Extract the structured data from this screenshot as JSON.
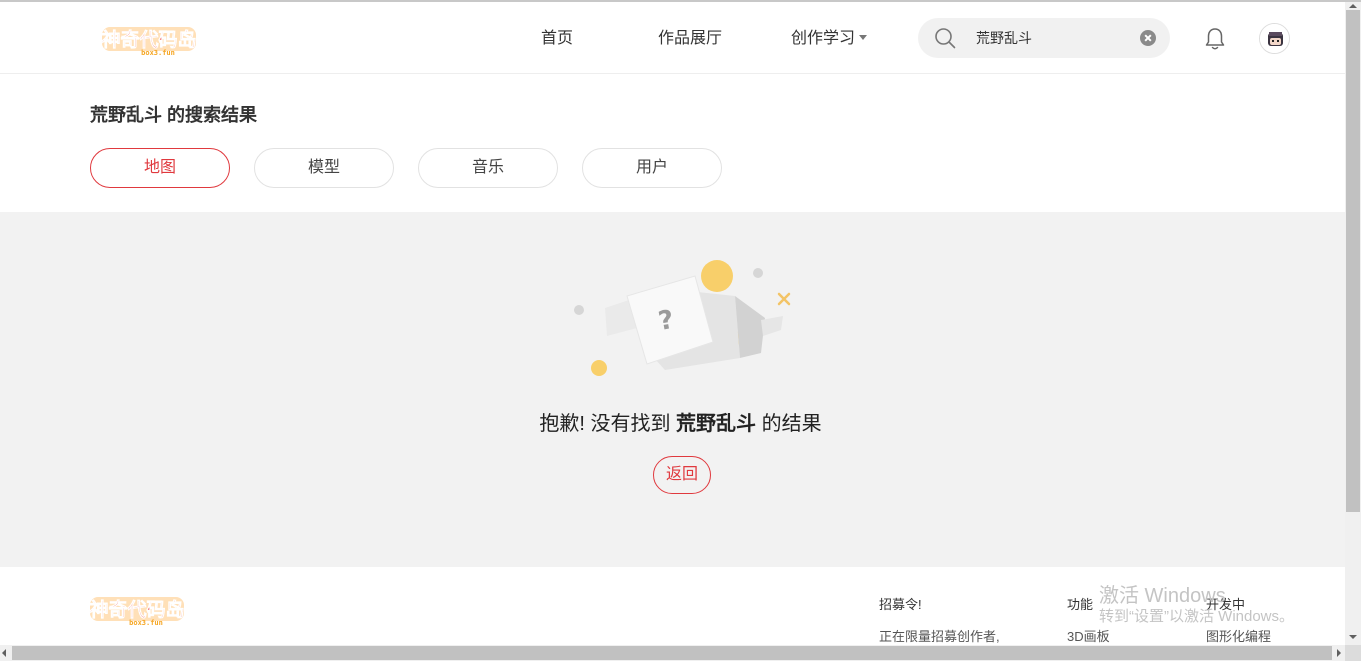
{
  "header": {
    "logo_text": "神奇代码岛",
    "logo_sub": "box3.fun",
    "nav": [
      {
        "label": "首页"
      },
      {
        "label": "作品展厅"
      },
      {
        "label": "创作学习"
      }
    ],
    "search_value": "荒野乱斗"
  },
  "results": {
    "keyword": "荒野乱斗",
    "title_suffix": " 的搜索结果",
    "tabs": [
      {
        "label": "地图",
        "active": true
      },
      {
        "label": "模型",
        "active": false
      },
      {
        "label": "音乐",
        "active": false
      },
      {
        "label": "用户",
        "active": false
      }
    ]
  },
  "empty": {
    "msg_prefix": "抱歉! 没有找到 ",
    "msg_keyword": "荒野乱斗",
    "msg_suffix": " 的结果",
    "back_label": "返回"
  },
  "footer": {
    "recruit_title": "招募令!",
    "recruit_text": "正在限量招募创作者,",
    "features_title": "功能",
    "features_item": "3D画板",
    "dev_title": "开发中",
    "dev_item": "图形化编程"
  },
  "watermark": {
    "line1": "激活 Windows",
    "line2": "转到“设置”以激活 Windows。"
  },
  "colors": {
    "accent": "#e0393e",
    "logo_red": "#e8322f",
    "logo_orange": "#f5a623",
    "empty_bg": "#f2f2f2"
  }
}
